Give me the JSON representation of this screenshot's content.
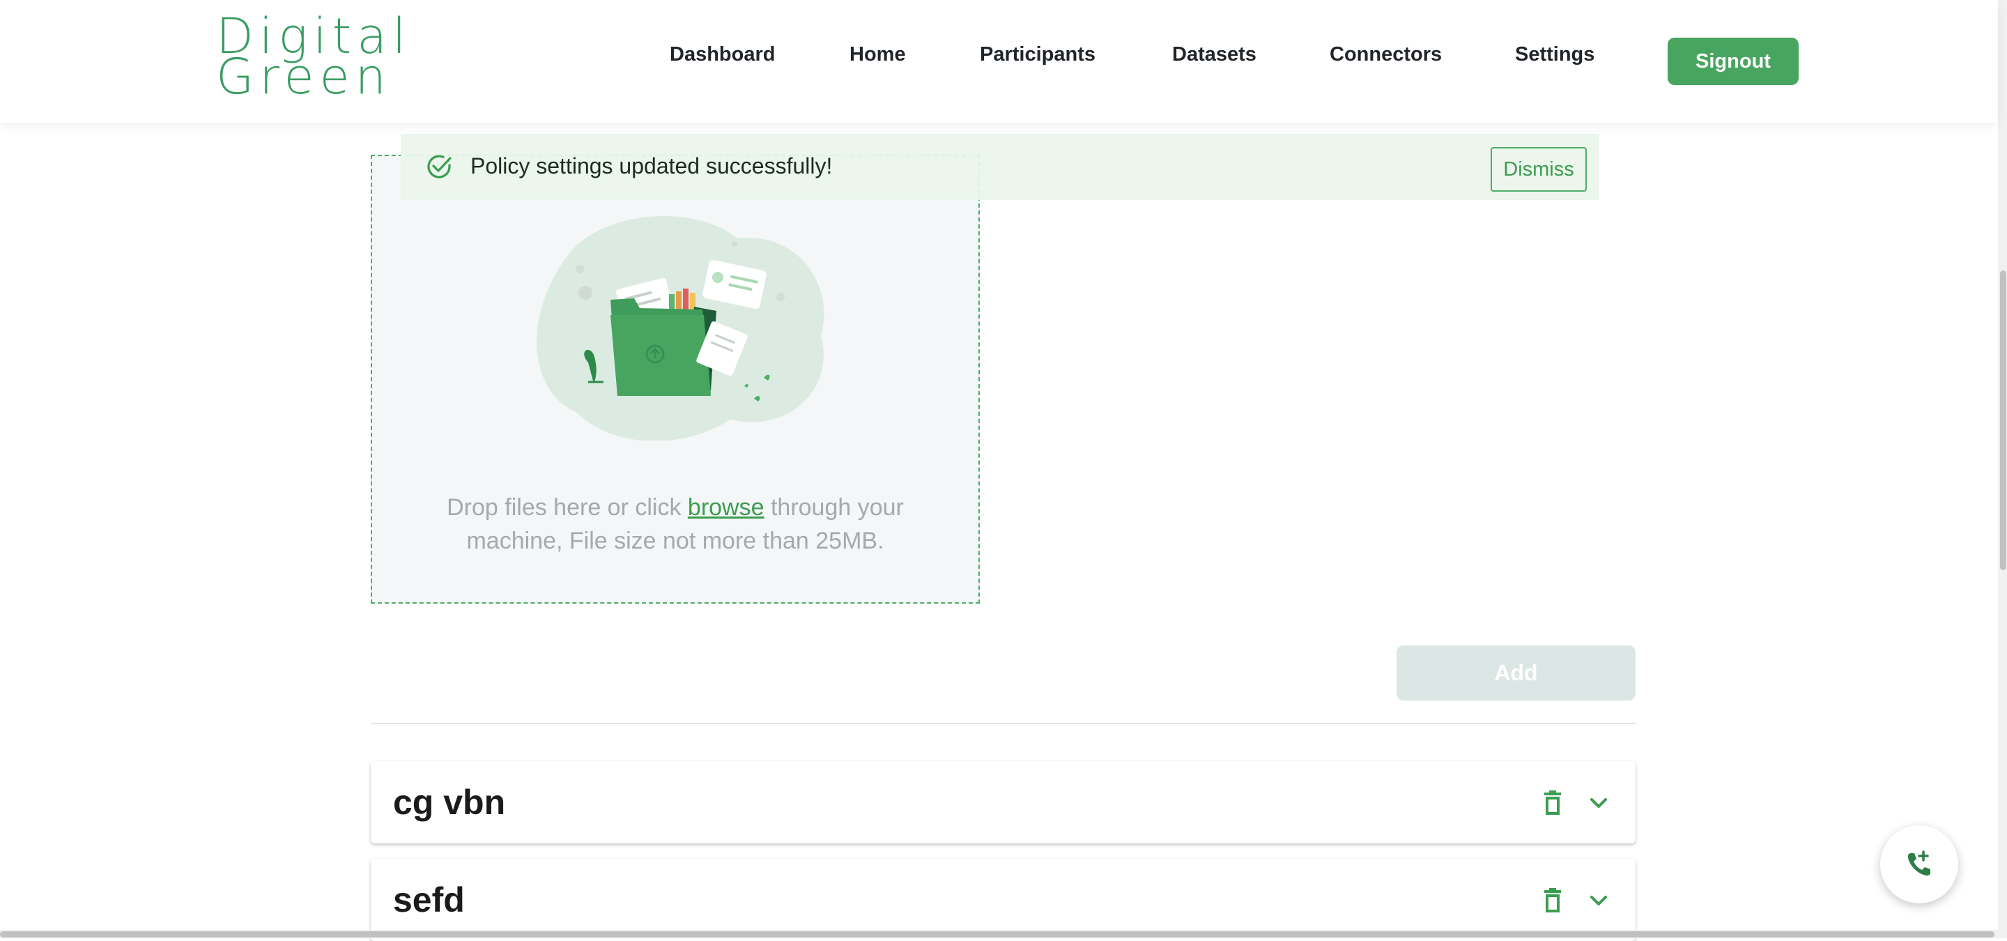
{
  "brand": {
    "line1": "Digital",
    "line2": "Green",
    "accent": "#47a55f"
  },
  "nav": {
    "items": [
      {
        "label": "Dashboard"
      },
      {
        "label": "Home"
      },
      {
        "label": "Participants"
      },
      {
        "label": "Datasets"
      },
      {
        "label": "Connectors"
      },
      {
        "label": "Settings"
      }
    ],
    "signout_label": "Signout"
  },
  "alert": {
    "message": "Policy settings updated successfully!",
    "dismiss_label": "Dismiss",
    "icon": "check-circle-icon"
  },
  "upload": {
    "text_before": "Drop files here or click ",
    "browse_label": "browse",
    "text_after": " through your machine, File size not more than 25MB.",
    "illustration": "folder-with-documents-illustration"
  },
  "actions": {
    "add_label": "Add"
  },
  "policies": [
    {
      "title": "cg vbn",
      "delete_icon": "trash-icon",
      "expand_icon": "chevron-down-icon"
    },
    {
      "title": "sefd",
      "delete_icon": "trash-icon",
      "expand_icon": "chevron-down-icon"
    }
  ],
  "fab": {
    "icon": "phone-add-icon"
  }
}
